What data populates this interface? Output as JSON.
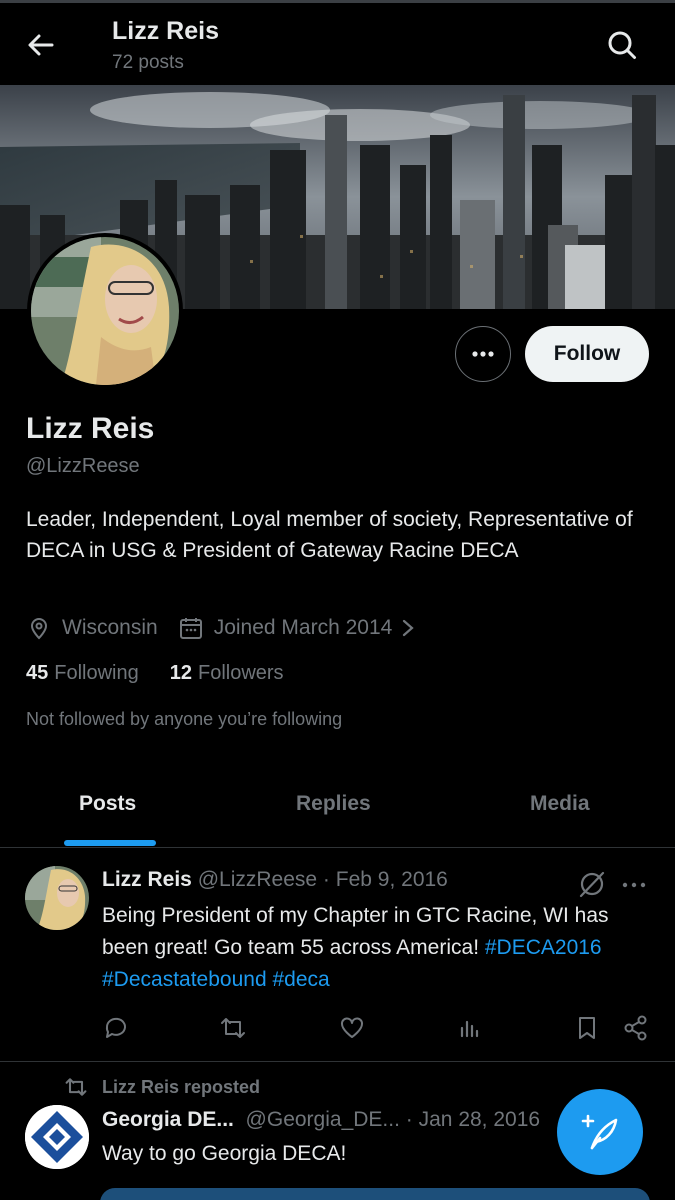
{
  "header": {
    "name": "Lizz Reis",
    "posts_count": "72 posts"
  },
  "profile": {
    "name": "Lizz Reis",
    "handle": "@LizzReese",
    "bio": "Leader, Independent, Loyal member of society, Representative of DECA in USG & President of Gateway Racine DECA",
    "location": "Wisconsin",
    "joined": "Joined March 2014",
    "following_count": "45",
    "following_label": "Following",
    "followers_count": "12",
    "followers_label": "Followers",
    "not_followed": "Not followed by anyone you’re following",
    "follow_button": "Follow"
  },
  "tabs": [
    {
      "label": "Posts",
      "active": true
    },
    {
      "label": "Replies",
      "active": false
    },
    {
      "label": "Media",
      "active": false
    }
  ],
  "posts": [
    {
      "author": "Lizz Reis",
      "handle": "@LizzReese",
      "date": "Feb 9, 2016",
      "text_part1": "Being President of my Chapter in GTC Racine, WI has been great! Go team 55 across America!",
      "hashtags": [
        "#DECA2016",
        "#Decastatebound",
        "#deca"
      ]
    },
    {
      "repost_label": "Lizz Reis reposted",
      "author": "Georgia DE...",
      "handle": "@Georgia_DE...",
      "date": "Jan 28, 2016",
      "text": "Way to go Georgia DECA!"
    }
  ],
  "icons": {
    "back": "arrow-left-icon",
    "search": "search-icon",
    "more": "more-horizontal-icon",
    "location": "location-pin-icon",
    "calendar": "calendar-icon",
    "chevron": "chevron-right-icon",
    "reply": "reply-icon",
    "repost": "repost-icon",
    "like": "heart-icon",
    "views": "views-icon",
    "bookmark": "bookmark-icon",
    "share": "share-icon",
    "grok": "grok-icon",
    "compose": "compose-icon"
  },
  "colors": {
    "background": "#000000",
    "accent": "#1d9bf0",
    "text_primary": "#e7e9ea",
    "text_secondary": "#71767b",
    "follow_bg": "#eff3f4"
  }
}
